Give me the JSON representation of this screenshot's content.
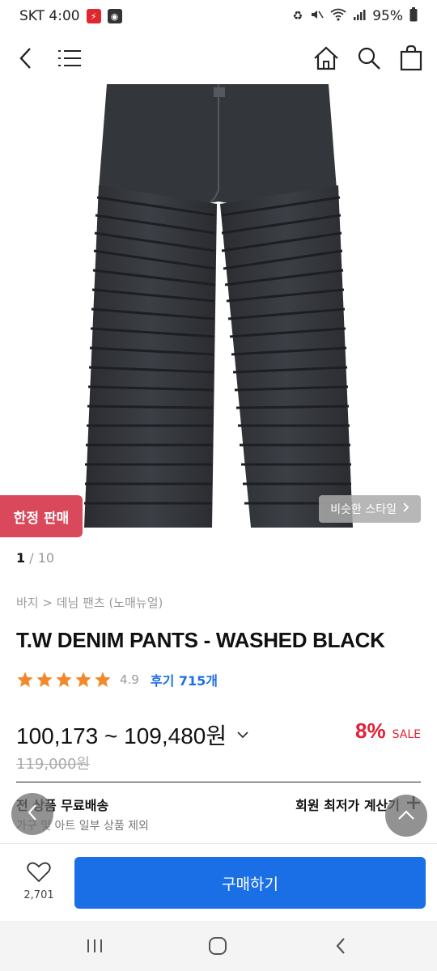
{
  "status_bar": {
    "carrier_time": "SKT 4:00",
    "battery": "95%",
    "icons": [
      "flash-notification-icon",
      "app-notification-icon",
      "battery-saver-icon",
      "mute-icon",
      "wifi-icon",
      "signal-icon",
      "battery-icon"
    ]
  },
  "nav": {
    "icons": [
      "back-icon",
      "menu-icon",
      "home-icon",
      "search-icon",
      "cart-icon"
    ]
  },
  "product": {
    "limited_badge": "한정 판매",
    "similar_style": "비슷한 스타일",
    "image_index": "1",
    "image_total": "/ 10",
    "breadcrumb": "바지 > 데님 팬츠 (노매뉴얼)",
    "title": "T.W DENIM PANTS - WASHED BLACK",
    "rating": "4.9",
    "rating_stars": 5,
    "reviews": "후기 715개",
    "price_range": "100,173 ~ 109,480원",
    "discount_pct": "8%",
    "discount_label": "SALE",
    "original_price": "119,000원"
  },
  "shipping": {
    "label": "전 상품 무료배송",
    "sub": "가구 및 아트 일부 상품 제외",
    "member_calc": "회원 최저가 계산기"
  },
  "purchase": {
    "like_count": "2,701",
    "buy_label": "구매하기"
  },
  "colors": {
    "accent_blue": "#1a6fe6",
    "sale_red": "#e02236",
    "badge_red": "#d9485b",
    "star_orange": "#f08a2c"
  }
}
